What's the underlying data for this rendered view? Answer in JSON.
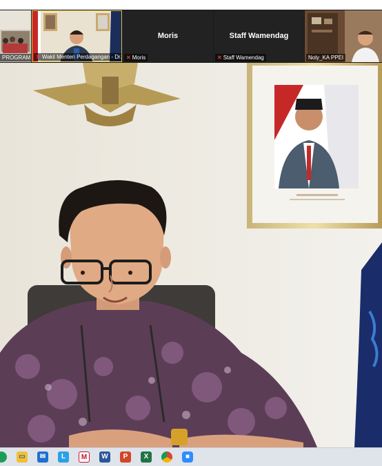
{
  "participants": [
    {
      "caption": "PROGRAM S...",
      "muted": false
    },
    {
      "caption": "Wakil Menteri Perdagangan - Dr...",
      "muted": true
    },
    {
      "display_name": "Moris",
      "caption": "Moris",
      "muted": true
    },
    {
      "display_name": "Staff Wamendag",
      "caption": "Staff Wamendag",
      "muted": true
    },
    {
      "caption": "Noly_KA PPEI",
      "muted": false
    }
  ],
  "taskbar": {
    "icons": [
      "chrome-app-icon",
      "file-explorer-icon",
      "mail-icon",
      "lync-icon",
      "mcafee-icon",
      "word-icon",
      "powerpoint-icon",
      "excel-icon",
      "chrome-icon",
      "zoom-icon"
    ]
  },
  "colors": {
    "mute": "#e0403c",
    "strip": "#1a1a1a",
    "taskbar": "#dfe3ea"
  }
}
